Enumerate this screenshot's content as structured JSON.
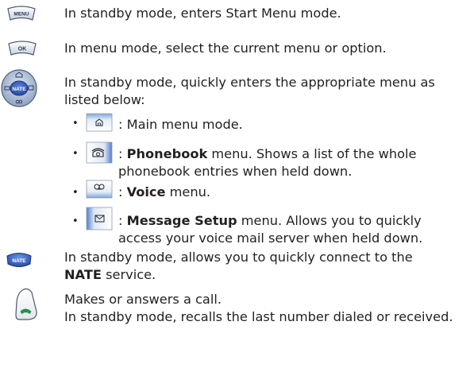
{
  "rows": [
    {
      "text": "In standby mode, enters Start Menu mode."
    },
    {
      "text": "In menu mode, select the current menu or option."
    },
    {
      "text": "In standby mode, quickly enters the appropriate menu as listed below:"
    },
    {
      "text_pre": "In standby mode, allows you to quickly connect to the",
      "text_bold": "NATE",
      "text_post": " service."
    },
    {
      "line1": "Makes or answers a call.",
      "line2": "In standby mode, recalls the last number dialed or received."
    }
  ],
  "sub_items": [
    {
      "text": ": Main menu mode."
    },
    {
      "bold": "Phonebook",
      "text": " menu. Shows a list of the whole phonebook entries when held down."
    },
    {
      "bold": "Voice",
      "text": " menu."
    },
    {
      "bold": "Message Setup",
      "text": " menu. Allows you to quickly access your voice mail server when held down."
    }
  ],
  "icons": {
    "menu_key": "MENU",
    "ok_key": "OK",
    "nav_key": "NATE",
    "nate_key": "NATE"
  },
  "bullet_char": "•",
  "colon": ": "
}
